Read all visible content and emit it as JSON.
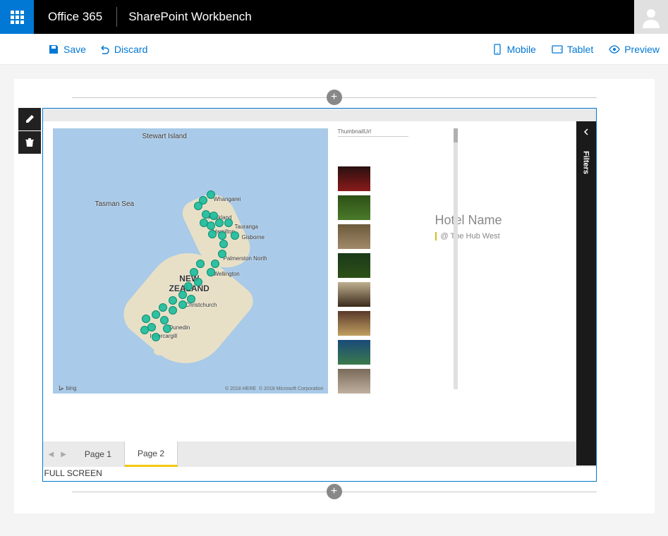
{
  "header": {
    "brand": "Office 365",
    "app": "SharePoint Workbench"
  },
  "commands": {
    "save": "Save",
    "discard": "Discard",
    "mobile": "Mobile",
    "tablet": "Tablet",
    "preview": "Preview"
  },
  "add_button": "+",
  "webpart": {
    "fullscreen": "FULL SCREEN",
    "filters_label": "Filters",
    "tabs": {
      "page1": "Page 1",
      "page2": "Page 2"
    },
    "map": {
      "country": "NEW\nZEALAND",
      "tasman": "Tasman Sea",
      "stewart": "Stewart Island",
      "bing": "bing",
      "copyright1": "© 2018 HERE",
      "copyright2": "© 2018 Microsoft Corporation",
      "places": {
        "whangarei": "Whangarei",
        "auckland": "Auckland",
        "hamilton": "Hamilton",
        "tauranga": "Tauranga",
        "gisborne": "Gisborne",
        "palmerston": "Palmerston North",
        "wellington": "Wellington",
        "christchurch": "Christchurch",
        "dunedin": "Dunedin",
        "invercargill": "Invercargill"
      }
    },
    "thumbs_header": "ThumbnailUrl",
    "detail": {
      "title": "Hotel Name",
      "subtitle": "@ The Hub West"
    }
  }
}
